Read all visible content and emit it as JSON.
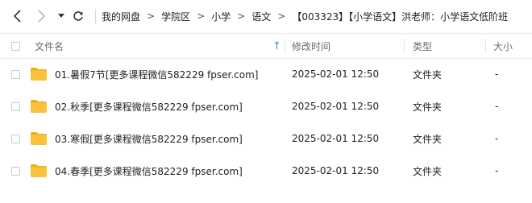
{
  "toolbar": {
    "back_icon": "chevron-left-icon",
    "forward_icon": "chevron-right-icon",
    "dropdown_icon": "caret-down-icon",
    "refresh_icon": "refresh-icon"
  },
  "breadcrumb": {
    "items": [
      "我的网盘",
      "学院区",
      "小学",
      "语文",
      "【003323】【小学语文】洪老师：小学语文低阶班"
    ],
    "separator": ">"
  },
  "columns": {
    "name": "文件名",
    "sort_indicator": "↑",
    "modified": "修改时间",
    "type": "类型",
    "size": "大小"
  },
  "files": [
    {
      "name": "01.暑假7节[更多课程微信582229 fpser.com]",
      "modified": "2025-02-01 12:50",
      "type": "文件夹",
      "size": "-"
    },
    {
      "name": "02.秋季[更多课程微信582229 fpser.com]",
      "modified": "2025-02-01 12:50",
      "type": "文件夹",
      "size": "-"
    },
    {
      "name": "03.寒假[更多课程微信582229 fpser.com]",
      "modified": "2025-02-01 12:50",
      "type": "文件夹",
      "size": "-"
    },
    {
      "name": "04.春季[更多课程微信582229 fpser.com]",
      "modified": "2025-02-01 12:50",
      "type": "文件夹",
      "size": "-"
    }
  ],
  "colors": {
    "folder": "#f8c33b",
    "folder_tab": "#f0ad16",
    "sort_arrow": "#3a8ee6"
  }
}
